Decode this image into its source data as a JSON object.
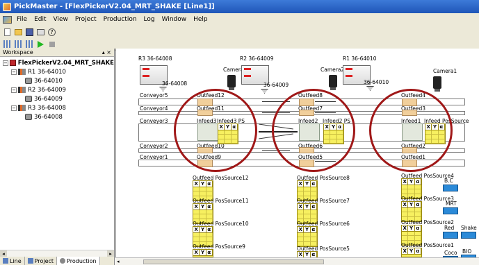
{
  "window": {
    "title": "PickMaster - [FlexPickerV2.04_MRT_SHAKE [Line1]]"
  },
  "menu": [
    "File",
    "Edit",
    "View",
    "Project",
    "Production",
    "Log",
    "Window",
    "Help"
  ],
  "workspace": {
    "title": "Workspace",
    "controls": "▴ ×",
    "tree": [
      {
        "label": "FlexPickerV2.04_MRT_SHAKE",
        "level": 0,
        "icon": "project-icon"
      },
      {
        "label": "R1 36-64010",
        "level": 1,
        "icon": "robot-icon"
      },
      {
        "label": "36-64010",
        "level": 2,
        "icon": "camera-icon"
      },
      {
        "label": "R2 36-64009",
        "level": 1,
        "icon": "robot-icon"
      },
      {
        "label": "36-64009",
        "level": 2,
        "icon": "camera-icon"
      },
      {
        "label": "R3 36-64008",
        "level": 1,
        "icon": "robot-icon"
      },
      {
        "label": "36-64008",
        "level": 2,
        "icon": "camera-icon"
      }
    ],
    "tabs": [
      "Line",
      "Project",
      "Production"
    ]
  },
  "canvas": {
    "robots": [
      "R3 36-64008",
      "R2 36-64009",
      "R1 36-64010"
    ],
    "tools": [
      "36-64008",
      "36-64009",
      "36-64010"
    ],
    "cameras": [
      "Camera3",
      "Camera2",
      "Camera1"
    ],
    "conveyors": [
      "Conveyor5",
      "Conveyor4",
      "Conveyor3",
      "Conveyor2",
      "Conveyor1"
    ],
    "outfeeds_top": [
      "Outfeed12",
      "Outfeed11",
      "Outfeed10",
      "Outfeed9"
    ],
    "outfeeds_mid": [
      "Outfeed8",
      "Outfeed7",
      "Outfeed6",
      "Outfeed5"
    ],
    "outfeeds_right": [
      "Outfeed4",
      "Outfeed3",
      "Outfeed2",
      "Outfeed1"
    ],
    "infeeds": [
      {
        "name": "Infeed3",
        "ps": "Infeed3 PS"
      },
      {
        "name": "Infeed2",
        "ps": "Infeed2 PS"
      },
      {
        "name": "Infeed1",
        "ps": "Infeed PosSource"
      }
    ],
    "ps_headers": [
      "X",
      "Y",
      "α"
    ],
    "possources_left": [
      "Outfeed PosSource12",
      "Outfeed PosSource11",
      "Outfeed PosSource10",
      "Outfeed PosSource9"
    ],
    "possources_mid": [
      "Outfeed PosSource8",
      "Outfeed PosSource7",
      "Outfeed PosSource6",
      "Outfeed PosSource5"
    ],
    "possources_right": [
      "Outfeed PosSource4",
      "Outfeed PosSource3",
      "Outfeed PosSource2",
      "Outfeed PosSource1"
    ],
    "items": [
      "B.C",
      "MRT",
      "Red",
      "Shake",
      "Coco",
      "BIO"
    ]
  },
  "colors": {
    "circle": "#a01818",
    "possource": "#f7f060",
    "tile": "#f1cf9b",
    "item": "#2b8ad8"
  }
}
